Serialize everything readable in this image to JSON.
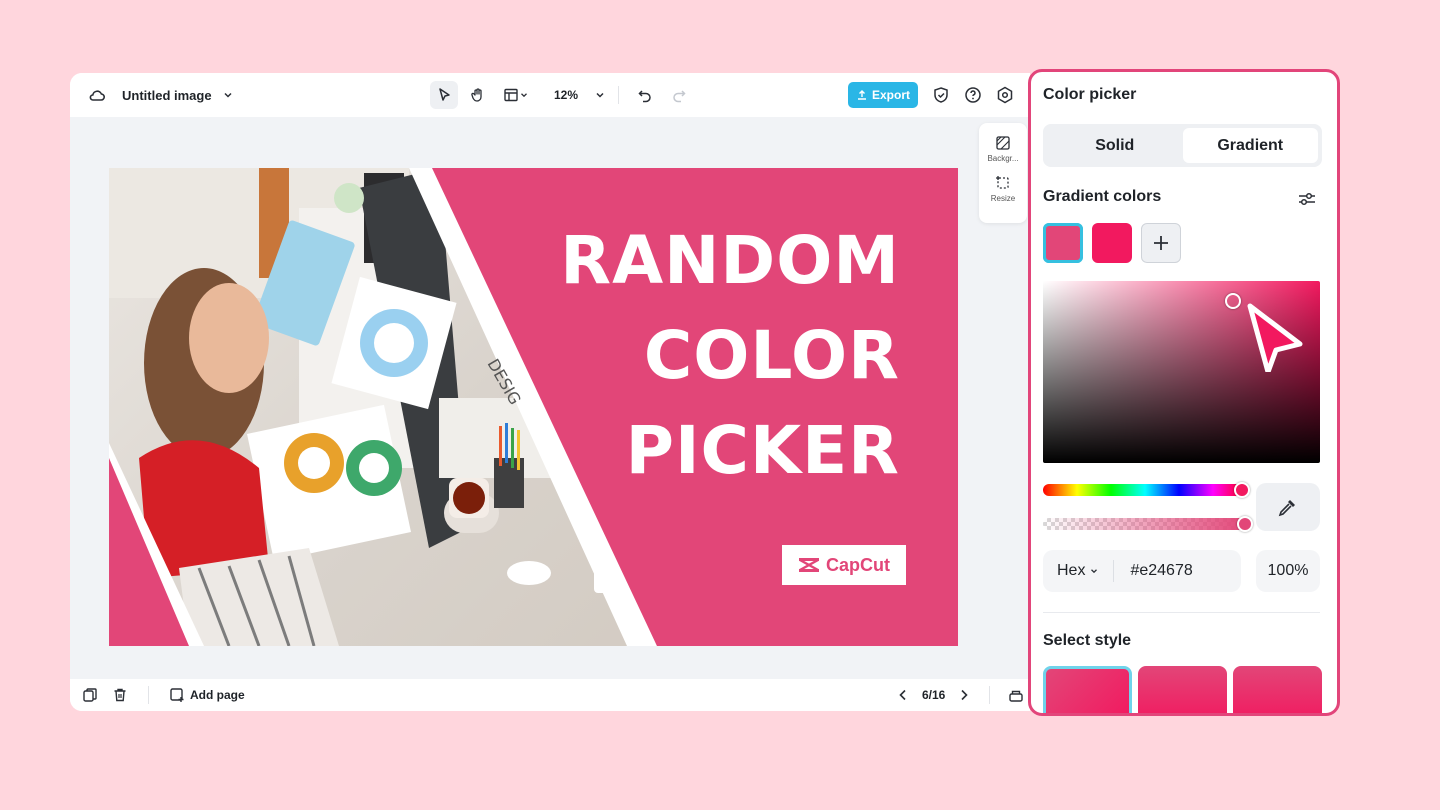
{
  "editor": {
    "doc_title": "Untitled image",
    "zoom": "12%",
    "export_label": "Export",
    "side_tools": [
      {
        "label": "Backgr..."
      },
      {
        "label": "Resize"
      }
    ],
    "add_page_label": "Add page",
    "page_indicator": "6/16"
  },
  "design": {
    "headline_lines": [
      "RANDOM",
      "COLOR",
      "PICKER"
    ],
    "logo_text": "CapCut",
    "bg_color": "#e24678",
    "sign_text": "DESIG"
  },
  "color_picker": {
    "title": "Color picker",
    "tabs": [
      {
        "label": "Solid",
        "active": false
      },
      {
        "label": "Gradient",
        "active": true
      }
    ],
    "gradient_colors_title": "Gradient colors",
    "gradient_colors": [
      "#e24678",
      "#f2195f"
    ],
    "hex_mode": "Hex",
    "hex_value": "#e24678",
    "opacity": "100%",
    "select_style_title": "Select style"
  },
  "colors": {
    "page_bg": "#ffd6dd",
    "accent": "#e2457a",
    "export_button": "#2ab6e6"
  }
}
